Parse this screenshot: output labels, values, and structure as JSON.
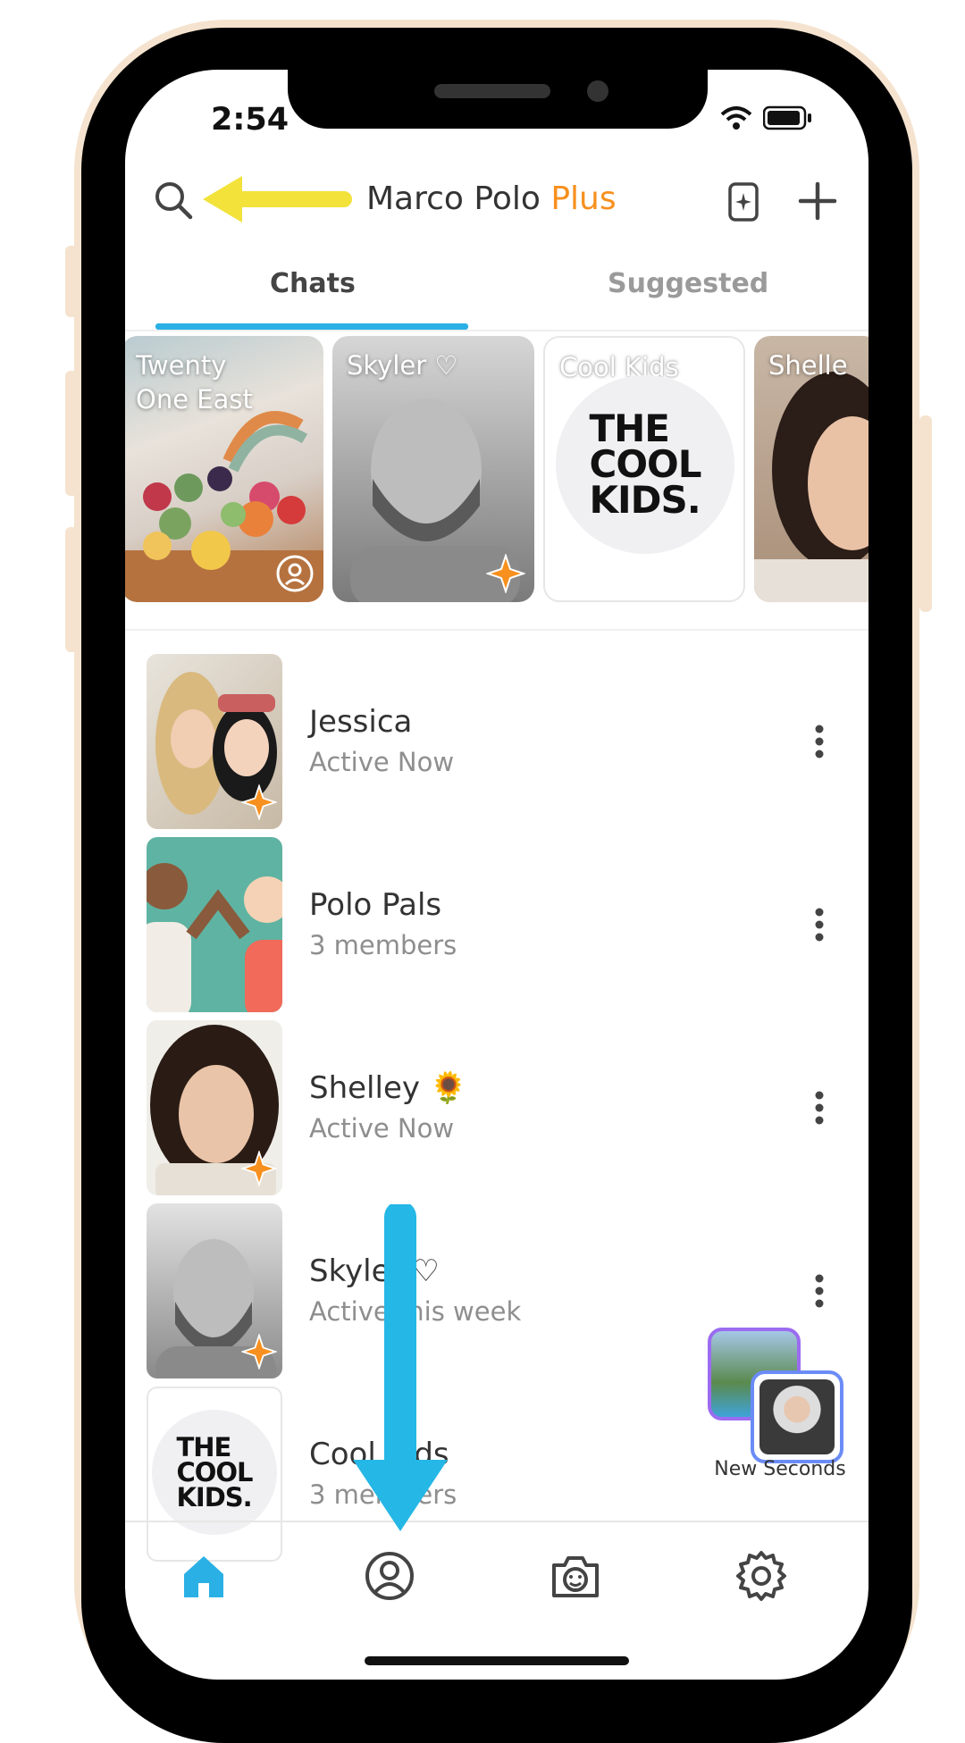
{
  "status_bar": {
    "time": "2:54"
  },
  "header": {
    "title": "Marco Polo",
    "title_accent": "Plus"
  },
  "tabs": [
    {
      "label": "Chats",
      "active": true
    },
    {
      "label": "Suggested",
      "active": false
    }
  ],
  "stories": [
    {
      "label": "Twenty\nOne East",
      "badge": "broadcast-icon"
    },
    {
      "label": "Skyler ♡",
      "badge": "sparkle-icon"
    },
    {
      "label": "Cool Kids",
      "logo": "THE\nCOOL\nKIDS."
    },
    {
      "label": "Shelle"
    }
  ],
  "chats": [
    {
      "name": "Jessica",
      "subtitle": "Active Now",
      "menu": "more-vertical-icon"
    },
    {
      "name": "Polo Pals",
      "subtitle": "3 members",
      "menu": "more-vertical-icon"
    },
    {
      "name": "Shelley 🌻",
      "subtitle": "Active Now",
      "menu": "more-vertical-icon"
    },
    {
      "name": "Skyler ♡",
      "subtitle": "Active this week",
      "menu": "more-vertical-icon"
    },
    {
      "name": "Cool Kids",
      "subtitle": "3 members",
      "logo": "THE\nCOOL\nKIDS."
    }
  ],
  "new_seconds": {
    "label": "New Seconds"
  },
  "bottom_nav": [
    {
      "icon": "home-icon",
      "active": true
    },
    {
      "icon": "profile-icon",
      "active": false
    },
    {
      "icon": "camera-icon",
      "active": false
    },
    {
      "icon": "settings-icon",
      "active": false
    }
  ],
  "colors": {
    "accent": "#2ab0e4",
    "plus": "#f7901e",
    "sparkle": "#f7901e",
    "annotation_yellow": "#f2e23a",
    "annotation_blue": "#25b7e6"
  }
}
